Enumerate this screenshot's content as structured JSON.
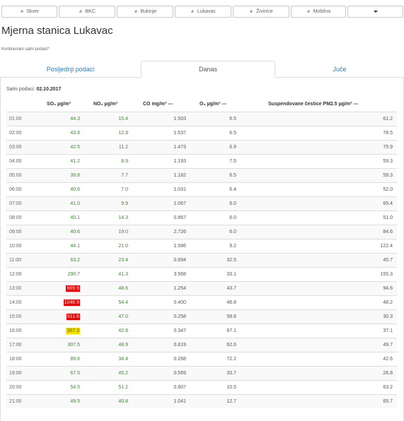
{
  "locations": [
    {
      "label": "Skver",
      "icon": "link-icon"
    },
    {
      "label": "BKC",
      "icon": "link-icon"
    },
    {
      "label": "Bukinje",
      "icon": "link-icon"
    },
    {
      "label": "Lukavac",
      "icon": "link-icon"
    },
    {
      "label": "Živinice",
      "icon": "link-icon"
    },
    {
      "label": "Mobilna",
      "icon": "link-icon"
    }
  ],
  "title": "Mjerna stanica Lukavac",
  "subtitle": "Kontinuirani satni podaci*",
  "tabs": [
    {
      "label": "Posljednji podaci",
      "active": false
    },
    {
      "label": "Danas",
      "active": true
    },
    {
      "label": "Juče",
      "active": false
    }
  ],
  "date_label": "Satni podaci:",
  "date_value": "02.10.2017",
  "headers": {
    "so2": "SO₂ µg/m³",
    "no2": "NO₂ µg/m³",
    "co": "CO mg/m³ ---",
    "o3": "O₃ µg/m³ ---",
    "pm": "Suspendovane čestice PM2.5 µg/m³ ---"
  },
  "colors": {
    "good": "#3a8a2e",
    "alert_red": "#e00000",
    "alert_yellow": "#f2e000",
    "link": "#337ab7"
  },
  "rows": [
    {
      "time": "01:00",
      "so2": "44.3",
      "no2": "15.4",
      "co": "1.503",
      "o3": "6.5",
      "pm": "61.2"
    },
    {
      "time": "02:00",
      "so2": "43.9",
      "no2": "12.9",
      "co": "1.537",
      "o3": "6.5",
      "pm": "78.5"
    },
    {
      "time": "03:00",
      "so2": "42.5",
      "no2": "11.2",
      "co": "1.473",
      "o3": "6.9",
      "pm": "75.9"
    },
    {
      "time": "04:00",
      "so2": "41.2",
      "no2": "8.9",
      "co": "1.193",
      "o3": "7.5",
      "pm": "59.3"
    },
    {
      "time": "05:00",
      "so2": "39.8",
      "no2": "7.7",
      "co": "1.182",
      "o3": "6.5",
      "pm": "59.3"
    },
    {
      "time": "06:00",
      "so2": "40.6",
      "no2": "7.0",
      "co": "1.031",
      "o3": "6.4",
      "pm": "52.0"
    },
    {
      "time": "07:00",
      "so2": "41.0",
      "no2": "9.9",
      "co": "1.067",
      "o3": "6.0",
      "pm": "65.4"
    },
    {
      "time": "08:00",
      "so2": "40.1",
      "no2": "14.3",
      "co": "0.867",
      "o3": "6.0",
      "pm": "51.0"
    },
    {
      "time": "09:00",
      "so2": "40.6",
      "no2": "19.0",
      "co": "2.726",
      "o3": "6.0",
      "pm": "84.6"
    },
    {
      "time": "10:00",
      "so2": "44.1",
      "no2": "21.0",
      "co": "1.586",
      "o3": "9.2",
      "pm": "122.4"
    },
    {
      "time": "11:00",
      "so2": "63.2",
      "no2": "23.4",
      "co": "0.694",
      "o3": "32.5",
      "pm": "45.7"
    },
    {
      "time": "12:00",
      "so2": "290.7",
      "no2": "41.3",
      "co": "3.568",
      "o3": "33.1",
      "pm": "155.3"
    },
    {
      "time": "13:00",
      "so2": "669.9",
      "no2": "48.6",
      "co": "1.254",
      "o3": "43.7",
      "pm": "94.6",
      "so2_alert": "red"
    },
    {
      "time": "14:00",
      "so2": "1046.9",
      "no2": "54.4",
      "co": "0.400",
      "o3": "46.8",
      "pm": "48.2",
      "so2_alert": "red"
    },
    {
      "time": "15:00",
      "so2": "611.6",
      "no2": "47.0",
      "co": "0.258",
      "o3": "58.6",
      "pm": "30.3",
      "so2_alert": "red"
    },
    {
      "time": "16:00",
      "so2": "387.3",
      "no2": "42.8",
      "co": "0.347",
      "o3": "67.1",
      "pm": "37.1",
      "so2_alert": "yellow"
    },
    {
      "time": "17:00",
      "so2": "307.5",
      "no2": "48.9",
      "co": "0.819",
      "o3": "62.6",
      "pm": "49.7"
    },
    {
      "time": "18:00",
      "so2": "89.6",
      "no2": "34.4",
      "co": "0.268",
      "o3": "72.2",
      "pm": "42.6"
    },
    {
      "time": "19:00",
      "so2": "67.5",
      "no2": "45.2",
      "co": "0.569",
      "o3": "33.7",
      "pm": "26.8"
    },
    {
      "time": "20:00",
      "so2": "54.5",
      "no2": "51.2",
      "co": "0.807",
      "o3": "10.5",
      "pm": "63.2"
    },
    {
      "time": "21:00",
      "so2": "49.5",
      "no2": "40.8",
      "co": "1.041",
      "o3": "12.7",
      "pm": "65.7"
    }
  ]
}
